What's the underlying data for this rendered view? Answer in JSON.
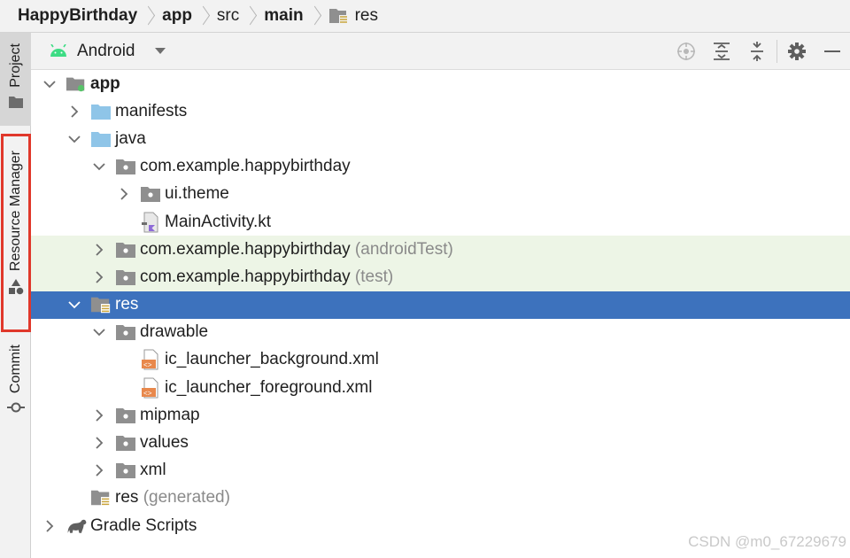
{
  "breadcrumb": {
    "items": [
      {
        "label": "HappyBirthday",
        "bold": true
      },
      {
        "label": "app",
        "bold": true
      },
      {
        "label": "src",
        "bold": false
      },
      {
        "label": "main",
        "bold": true
      },
      {
        "label": "res",
        "bold": false
      }
    ]
  },
  "tool_strip": {
    "project": "Project",
    "resource_manager": "Resource Manager",
    "commit": "Commit"
  },
  "toolbar": {
    "view_mode": "Android",
    "icons": [
      "locate-icon",
      "expand-all-icon",
      "collapse-all-icon",
      "gear-icon",
      "hide-icon"
    ]
  },
  "tree": [
    {
      "label": "app",
      "suffix": "",
      "depth": 0,
      "chevron": "down",
      "icon": "module",
      "bold": true,
      "bg": "none"
    },
    {
      "label": "manifests",
      "suffix": "",
      "depth": 1,
      "chevron": "right",
      "icon": "folder-blue",
      "bold": false,
      "bg": "none"
    },
    {
      "label": "java",
      "suffix": "",
      "depth": 1,
      "chevron": "down",
      "icon": "folder-blue",
      "bold": false,
      "bg": "none"
    },
    {
      "label": "com.example.happybirthday",
      "suffix": "",
      "depth": 2,
      "chevron": "down",
      "icon": "package",
      "bold": false,
      "bg": "none"
    },
    {
      "label": "ui.theme",
      "suffix": "",
      "depth": 3,
      "chevron": "right",
      "icon": "package",
      "bold": false,
      "bg": "none"
    },
    {
      "label": "MainActivity.kt",
      "suffix": "",
      "depth": 3,
      "chevron": "none",
      "icon": "kotlin",
      "bold": false,
      "bg": "none"
    },
    {
      "label": "com.example.happybirthday",
      "suffix": "(androidTest)",
      "depth": 2,
      "chevron": "right",
      "icon": "package",
      "bold": false,
      "bg": "test"
    },
    {
      "label": "com.example.happybirthday",
      "suffix": "(test)",
      "depth": 2,
      "chevron": "right",
      "icon": "package",
      "bold": false,
      "bg": "test"
    },
    {
      "label": "res",
      "suffix": "",
      "depth": 1,
      "chevron": "down",
      "icon": "res-folder",
      "bold": false,
      "bg": "selected"
    },
    {
      "label": "drawable",
      "suffix": "",
      "depth": 2,
      "chevron": "down",
      "icon": "package",
      "bold": false,
      "bg": "none"
    },
    {
      "label": "ic_launcher_background.xml",
      "suffix": "",
      "depth": 3,
      "chevron": "none",
      "icon": "xml",
      "bold": false,
      "bg": "none"
    },
    {
      "label": "ic_launcher_foreground.xml",
      "suffix": "",
      "depth": 3,
      "chevron": "none",
      "icon": "xml",
      "bold": false,
      "bg": "none"
    },
    {
      "label": "mipmap",
      "suffix": "",
      "depth": 2,
      "chevron": "right",
      "icon": "package",
      "bold": false,
      "bg": "none"
    },
    {
      "label": "values",
      "suffix": "",
      "depth": 2,
      "chevron": "right",
      "icon": "package",
      "bold": false,
      "bg": "none"
    },
    {
      "label": "xml",
      "suffix": "",
      "depth": 2,
      "chevron": "right",
      "icon": "package",
      "bold": false,
      "bg": "none"
    },
    {
      "label": "res",
      "suffix": "(generated)",
      "depth": 1,
      "chevron": "none",
      "icon": "res-folder",
      "bold": false,
      "bg": "none"
    },
    {
      "label": "Gradle Scripts",
      "suffix": "",
      "depth": 0,
      "chevron": "right",
      "icon": "gradle",
      "bold": false,
      "bg": "none"
    }
  ],
  "watermark": "CSDN @m0_67229679"
}
